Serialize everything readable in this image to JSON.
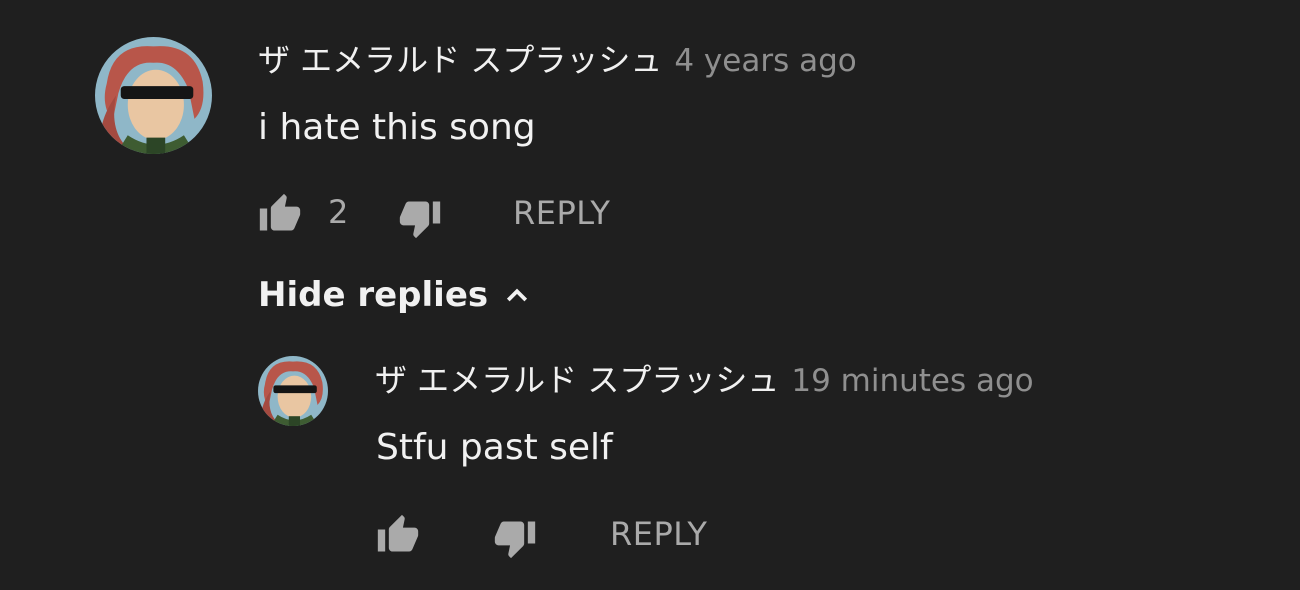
{
  "comment": {
    "author": "ザ エメラルド スプラッシュ",
    "time": "4 years ago",
    "text": "i hate this song",
    "like_count": "2",
    "reply_label": "REPLY",
    "hide_replies_label": "Hide replies",
    "avatar_icon": "avatar-icon"
  },
  "reply": {
    "author": "ザ エメラルド スプラッシュ",
    "time": "19 minutes ago",
    "text": "Stfu past self",
    "reply_label": "REPLY",
    "avatar_icon": "avatar-icon"
  },
  "colors": {
    "background": "#1f1f1f",
    "primary_text": "#f1f1f1",
    "secondary_text": "#aaaaaa",
    "timestamp": "#8f8f8f"
  },
  "icons": {
    "like": "thumbs-up-icon",
    "dislike": "thumbs-down-icon",
    "hide": "chevron-up-icon"
  }
}
